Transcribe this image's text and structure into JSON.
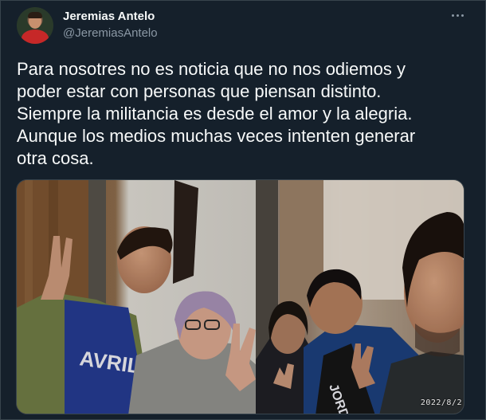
{
  "author": {
    "name": "Jeremias Antelo",
    "handle": "@JeremiasAntelo",
    "avatar_icon": "profile-avatar"
  },
  "menu": {
    "icon": "more-horizontal-icon"
  },
  "tweet": {
    "lines": [
      "Para nosotres no es noticia que no nos odiemos y",
      "poder estar con personas que piensan distinto.",
      "Siempre la militancia es desde el amor y la alegria.",
      "Aunque los medios muchas veces intenten generar",
      "otra cosa."
    ]
  },
  "photo": {
    "timestamp": "2022/8/2",
    "shirt_print": "AVRIL",
    "jacket_print": "JORDAN"
  },
  "colors": {
    "background": "#15202b",
    "text": "#f7f9f9",
    "secondary_text": "#8b98a5",
    "border": "#38444d"
  }
}
